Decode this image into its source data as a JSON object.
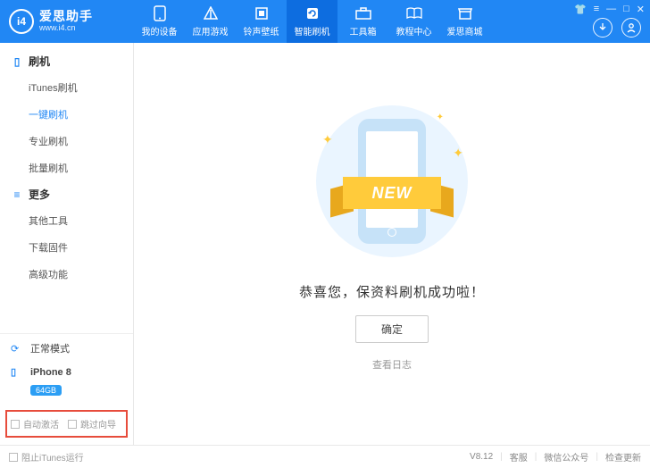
{
  "app": {
    "name": "爱思助手",
    "site": "www.i4.cn",
    "logo_text": "i4"
  },
  "nav": {
    "items": [
      {
        "label": "我的设备",
        "key": "device"
      },
      {
        "label": "应用游戏",
        "key": "apps"
      },
      {
        "label": "铃声壁纸",
        "key": "ring"
      },
      {
        "label": "智能刷机",
        "key": "flash"
      },
      {
        "label": "工具箱",
        "key": "tools"
      },
      {
        "label": "教程中心",
        "key": "tutorial"
      },
      {
        "label": "爱思商城",
        "key": "mall"
      }
    ],
    "active": "flash"
  },
  "sidebar": {
    "sections": [
      {
        "title": "刷机",
        "items": [
          {
            "label": "iTunes刷机"
          },
          {
            "label": "一键刷机",
            "active": true
          },
          {
            "label": "专业刷机"
          },
          {
            "label": "批量刷机"
          }
        ]
      },
      {
        "title": "更多",
        "items": [
          {
            "label": "其他工具"
          },
          {
            "label": "下载固件"
          },
          {
            "label": "高级功能"
          }
        ]
      }
    ],
    "mode_label": "正常模式",
    "device": {
      "name": "iPhone 8",
      "storage": "64GB"
    },
    "options": [
      {
        "label": "自动激活"
      },
      {
        "label": "跳过向导"
      }
    ]
  },
  "main": {
    "ribbon": "NEW",
    "message": "恭喜您，保资料刷机成功啦！",
    "confirm_label": "确定",
    "log_link": "查看日志"
  },
  "footer": {
    "block_itunes": "阻止iTunes运行",
    "version": "V8.12",
    "links": [
      "客服",
      "微信公众号",
      "检查更新"
    ]
  }
}
